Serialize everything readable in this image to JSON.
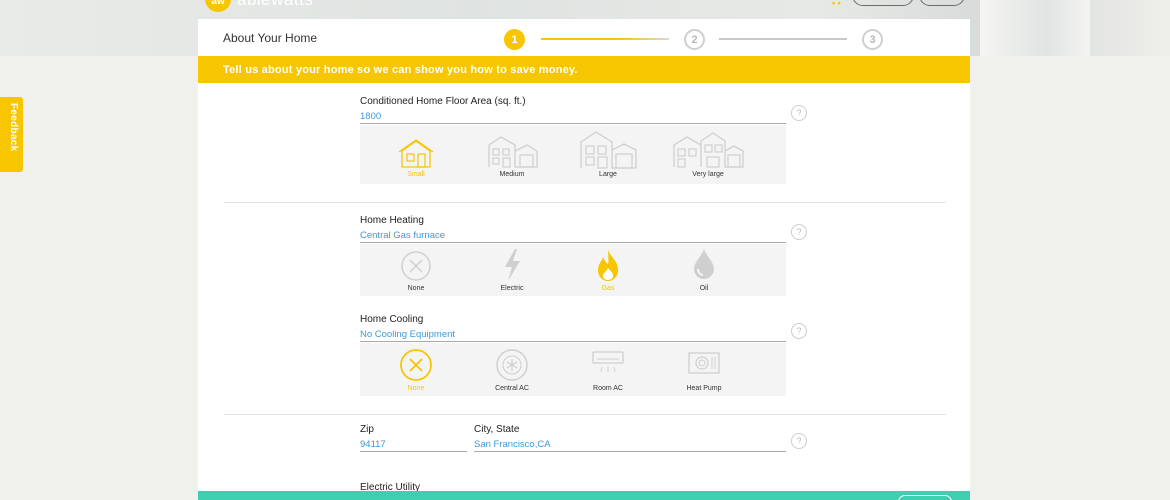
{
  "brand": {
    "name": "ablewatts",
    "logo_mark": "aw"
  },
  "header": {
    "menu_dots": "• •"
  },
  "feedback": {
    "label": "Feedback"
  },
  "wizard": {
    "title": "About Your Home",
    "steps": [
      {
        "number": "1",
        "state": "active"
      },
      {
        "number": "2",
        "state": "inactive"
      },
      {
        "number": "3",
        "state": "inactive"
      }
    ],
    "banner": "Tell us about your home so we can show you how to save money."
  },
  "floor_area": {
    "label": "Conditioned Home Floor Area (sq. ft.)",
    "value": "1800",
    "options": [
      {
        "label": "Small",
        "icon": "small-house-icon",
        "selected": true
      },
      {
        "label": "Medium",
        "icon": "medium-house-icon",
        "selected": false
      },
      {
        "label": "Large",
        "icon": "large-house-icon",
        "selected": false
      },
      {
        "label": "Very large",
        "icon": "very-large-house-icon",
        "selected": false
      }
    ]
  },
  "heating": {
    "label": "Home Heating",
    "value": "Central Gas furnace",
    "options": [
      {
        "label": "None",
        "icon": "none-x-icon",
        "selected": false
      },
      {
        "label": "Electric",
        "icon": "lightning-icon",
        "selected": false
      },
      {
        "label": "Gas",
        "icon": "flame-icon",
        "selected": true
      },
      {
        "label": "Oil",
        "icon": "oil-drop-icon",
        "selected": false
      }
    ]
  },
  "cooling": {
    "label": "Home Cooling",
    "value": "No Cooling Equipment",
    "options": [
      {
        "label": "None",
        "icon": "none-x-icon",
        "selected": true
      },
      {
        "label": "Central AC",
        "icon": "snowflake-icon",
        "selected": false
      },
      {
        "label": "Room AC",
        "icon": "room-ac-icon",
        "selected": false
      },
      {
        "label": "Heat Pump",
        "icon": "heat-pump-icon",
        "selected": false
      }
    ]
  },
  "location": {
    "zip_label": "Zip",
    "zip_value": "94117",
    "city_label": "City, State",
    "city_value": "San Francisco,CA"
  },
  "utility": {
    "label": "Electric Utility"
  },
  "help_symbol": "?",
  "colors": {
    "accent": "#f7c600",
    "link": "#3a9ad9",
    "footer": "#3ecfb0"
  }
}
